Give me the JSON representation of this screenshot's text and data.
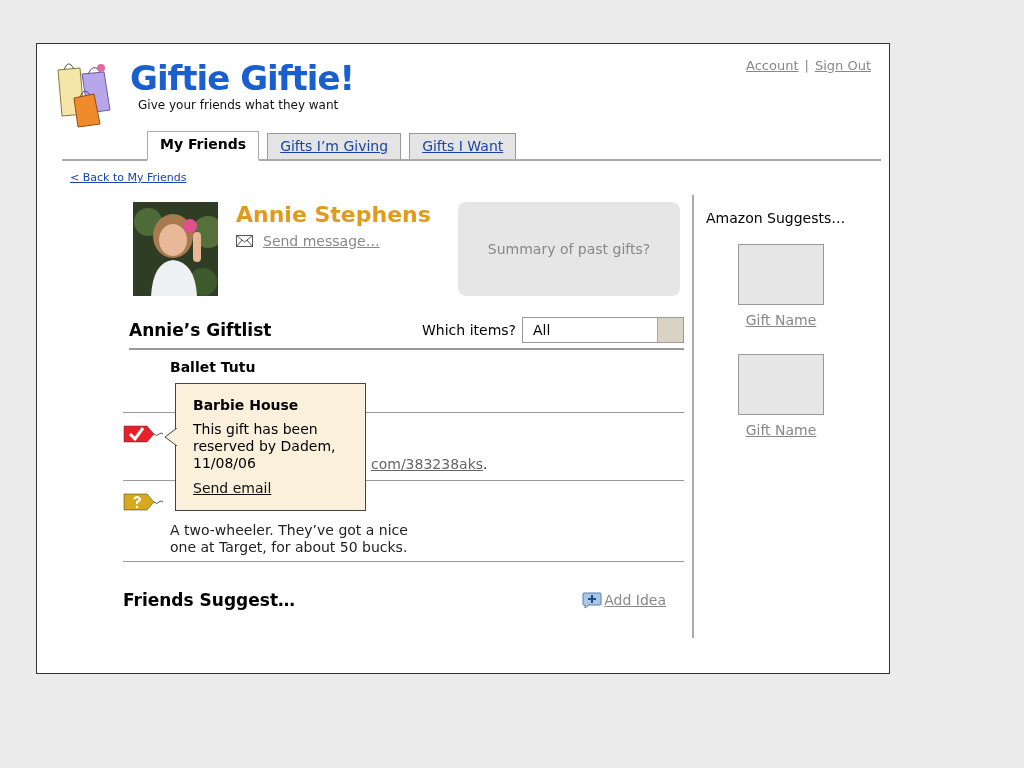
{
  "header": {
    "title": "Giftie Giftie!",
    "tagline": "Give your friends what they want",
    "links": [
      "Account",
      "Sign Out"
    ],
    "separator": "|"
  },
  "tabs": [
    {
      "label": "My Friends",
      "selected": true
    },
    {
      "label": "Gifts I’m Giving",
      "selected": false
    },
    {
      "label": "Gifts I Want",
      "selected": false
    }
  ],
  "back_link": "< Back to My Friends",
  "profile": {
    "name": "Annie Stephens",
    "message_link": "Send message…",
    "summary": "Summary of past gifts?"
  },
  "giftlist": {
    "title": "Annie’s Giftlist",
    "filter_label": "Which items?",
    "filter_value": "All",
    "items": [
      {
        "kind": "plain",
        "title": "Ballet Tutu"
      },
      {
        "kind": "reserved",
        "description": [
          {
            "kind": "link",
            "text": "com/383238aks"
          },
          {
            "kind": "text",
            "text": "."
          }
        ]
      },
      {
        "kind": "unknown",
        "description": [
          {
            "kind": "text",
            "text": "A two-wheeler. They’ve got a nice one at Target, for about 50 bucks."
          }
        ]
      }
    ]
  },
  "popover": {
    "title": "Barbie House",
    "text": "This gift has been reserved by Dadem, 11/08/06",
    "link": "Send email"
  },
  "friends_suggest": {
    "title": "Friends Suggest…",
    "add_link": "Add Idea"
  },
  "amazon": {
    "title": "Amazon Suggests…",
    "items": [
      "Gift Name",
      "Gift Name"
    ]
  }
}
